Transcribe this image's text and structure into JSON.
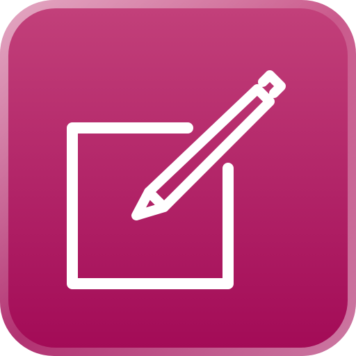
{
  "icon": {
    "name": "edit-compose-icon",
    "colors": {
      "background_top": "#c2407a",
      "background_bottom": "#a30b57",
      "rim_highlight": "#e59abd",
      "glyph": "#ffffff"
    }
  }
}
